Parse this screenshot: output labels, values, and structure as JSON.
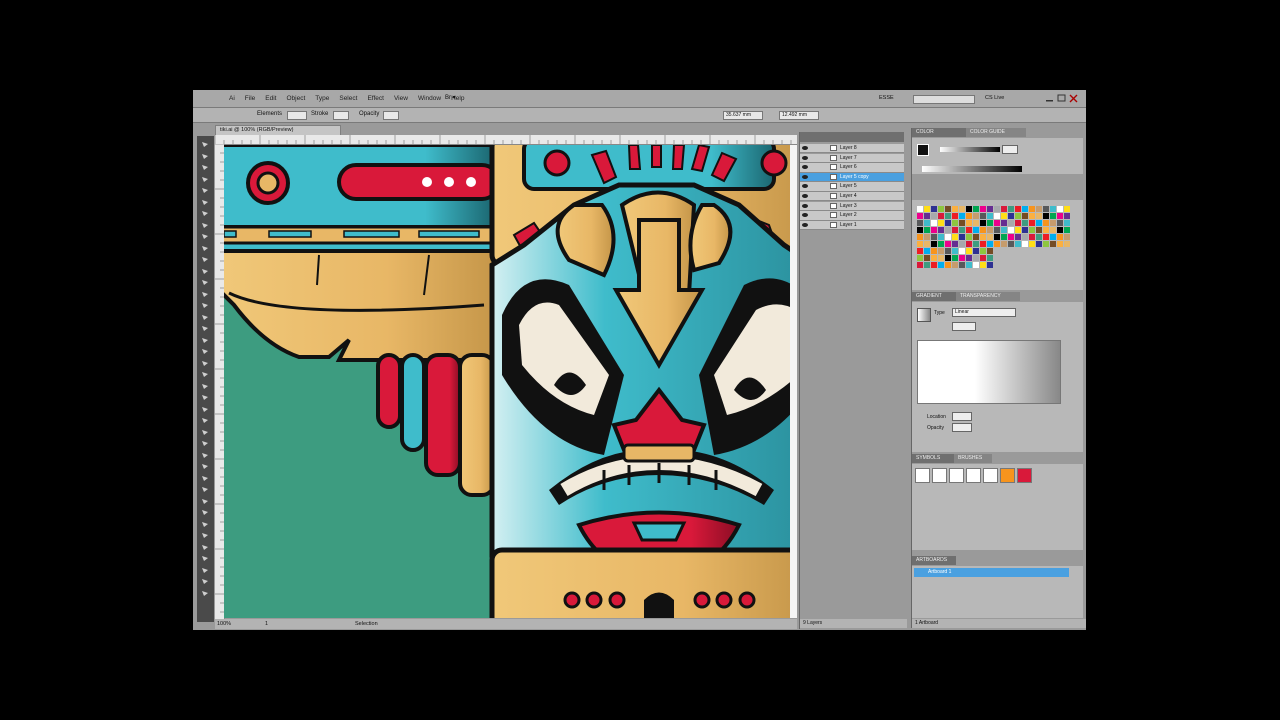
{
  "menubar": {
    "menus": [
      "Ai",
      "File",
      "Edit",
      "Object",
      "Type",
      "Select",
      "Effect",
      "View",
      "Window",
      "Help"
    ],
    "zoom_menu": "Br ▾",
    "workspace": "ESSE",
    "cs_live": "CS Live"
  },
  "control_bar": {
    "label_left": "Elements",
    "label_stroke": "Stroke",
    "label_opacity": "Opacity",
    "field_x": "35.637 mm",
    "field_y": "12.492 mm"
  },
  "document": {
    "tab_label": "tiki.ai @ 100% (RGB/Preview)"
  },
  "status": {
    "zoom": "100%",
    "page": "1",
    "tool": "Selection"
  },
  "layers": {
    "rows": [
      {
        "name": "Layer 8",
        "selected": false
      },
      {
        "name": "Layer 7",
        "selected": false
      },
      {
        "name": "Layer 6",
        "selected": false
      },
      {
        "name": "Layer 5 copy",
        "selected": true
      },
      {
        "name": "Layer 5",
        "selected": false
      },
      {
        "name": "Layer 4",
        "selected": false
      },
      {
        "name": "Layer 3",
        "selected": false
      },
      {
        "name": "Layer 2",
        "selected": false
      },
      {
        "name": "Layer 1",
        "selected": false
      }
    ],
    "footer": "9 Layers"
  },
  "panels": {
    "color_tab": "COLOR",
    "guide_tab": "COLOR GUIDE",
    "gradient_tab": "GRADIENT",
    "transparency_tab": "TRANSPARENCY",
    "gradient_type": "Linear",
    "location_label": "Location",
    "opacity_label": "Opacity",
    "symbols_tab": "SYMBOLS",
    "brushes_tab": "BRUSHES",
    "artboards_tab": "ARTBOARDS",
    "artboard_name": "Artboard 1",
    "artboards_footer": "1 Artboard"
  },
  "colors": {
    "teal": "#3fbccb",
    "red": "#d9193a",
    "gold": "#e8b766",
    "cream": "#f2eadb",
    "green": "#3d9c80",
    "outline": "#111111"
  }
}
